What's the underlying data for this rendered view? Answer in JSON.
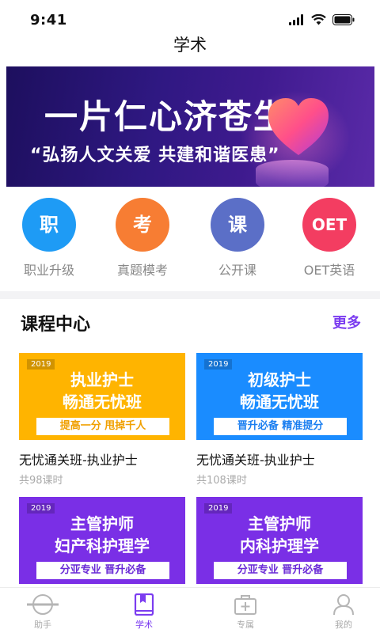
{
  "status_bar": {
    "time": "9:41"
  },
  "nav": {
    "title": "学术"
  },
  "banner": {
    "headline": "一片仁心济苍生",
    "slogan": "“弘扬人文关爱 共建和谐医患”"
  },
  "quick_entries": [
    {
      "glyph": "职",
      "label": "职业升级",
      "color": "#1e9bf5"
    },
    {
      "glyph": "考",
      "label": "真题模考",
      "color": "#f77d33"
    },
    {
      "glyph": "课",
      "label": "公开课",
      "color": "#5b6fc7"
    },
    {
      "glyph": "OET",
      "label": "OET英语",
      "color": "#f33d61"
    }
  ],
  "course_center": {
    "title": "课程中心",
    "more_label": "更多",
    "courses": [
      {
        "year": "2019",
        "cover_line1": "执业护士",
        "cover_line2": "畅通无忧班",
        "tag": "提高一分 甩掉千人",
        "name": "无忧通关班-执业护士",
        "lessons": "共98课时",
        "cover_color": "#ffb400",
        "tag_color": "#f0a000"
      },
      {
        "year": "2019",
        "cover_line1": "初级护士",
        "cover_line2": "畅通无忧班",
        "tag": "晋升必备 精准提分",
        "name": "无忧通关班-执业护士",
        "lessons": "共108课时",
        "cover_color": "#1a8cff",
        "tag_color": "#1a7ef0"
      },
      {
        "year": "2019",
        "cover_line1": "主管护师",
        "cover_line2": "妇产科护理学",
        "tag": "分亚专业 晋升必备",
        "cover_color": "#7a2fe6",
        "tag_color": "#6a2ad6"
      },
      {
        "year": "2019",
        "cover_line1": "主管护师",
        "cover_line2": "内科护理学",
        "tag": "分亚专业 晋升必备",
        "cover_color": "#7a2fe6",
        "tag_color": "#6a2ad6"
      }
    ]
  },
  "tab_bar": {
    "active_color": "#7b3cf0",
    "tabs": [
      {
        "label": "助手",
        "icon": "assistant-icon",
        "active": false
      },
      {
        "label": "学术",
        "icon": "book-icon",
        "active": true
      },
      {
        "label": "专属",
        "icon": "medical-kit-icon",
        "active": false
      },
      {
        "label": "我的",
        "icon": "user-icon",
        "active": false
      }
    ]
  }
}
